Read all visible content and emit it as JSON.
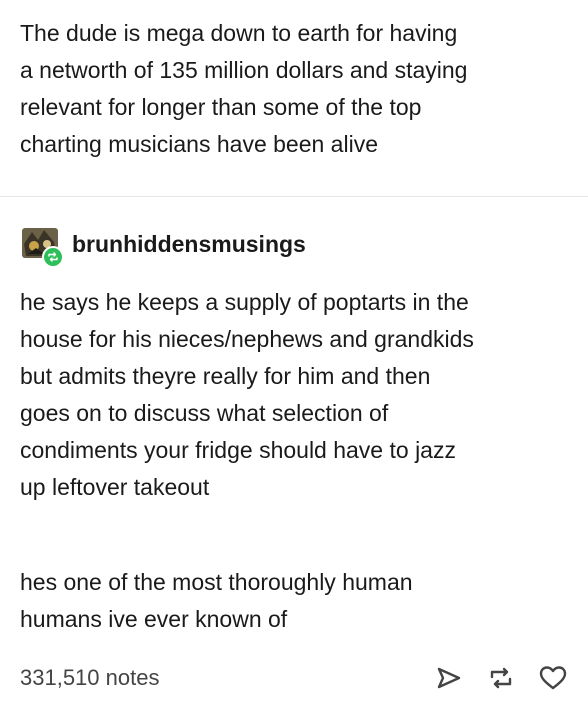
{
  "original_post": {
    "text": "The dude is mega down to earth for having\na networth of 135 million dollars and staying\nrelevant for longer than some of the top\ncharting musicians have been alive"
  },
  "reblog": {
    "username": "brunhiddensmusings",
    "paragraph_1": "he says he keeps a supply of poptarts in the\nhouse for his nieces/nephews and grandkids\nbut admits theyre really for him and then\ngoes on to discuss what selection of\ncondiments your fridge should have to jazz\nup leftover takeout",
    "paragraph_2": "hes one of the most thoroughly human\nhumans ive ever known of"
  },
  "footer": {
    "notes": "331,510 notes",
    "icons": [
      "share-icon",
      "reblog-icon",
      "like-icon"
    ]
  },
  "colors": {
    "text": "#1a1a1a",
    "reblog_badge": "#2fbf5a",
    "divider": "#e6e6e6"
  }
}
